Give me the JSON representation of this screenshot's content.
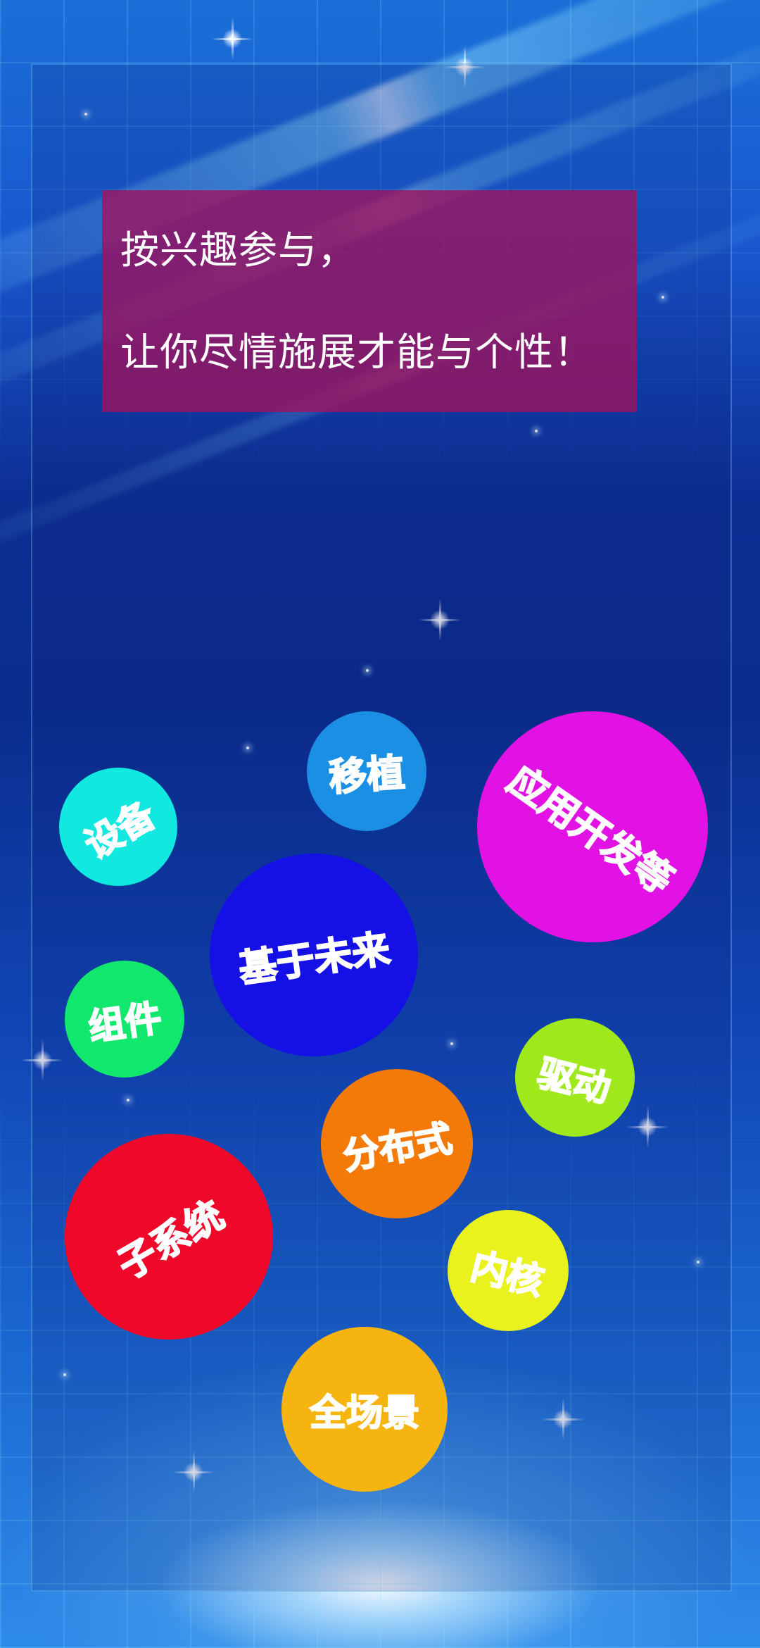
{
  "card": {
    "line1": "按兴趣参与，",
    "line2": "让你尽情施展才能与个性！"
  },
  "bubbles": {
    "yizhi": "移植",
    "yingyong": "应用开发等",
    "shebei": "设备",
    "jiyu": "基于未来",
    "zujian": "组件",
    "qudong": "驱动",
    "fenbushi": "分布式",
    "zixitong": "子系统",
    "neihe": "内核",
    "quanchangjing": "全场景"
  },
  "colors": {
    "card_bg": "#a0125c",
    "yizhi": "#1a8fe3",
    "yingyong": "#e212e4",
    "shebei": "#10e8e0",
    "jiyu": "#1410e6",
    "zujian": "#12e86e",
    "qudong": "#9ee81c",
    "fenbushi": "#f47a08",
    "zixitong": "#f0082a",
    "neihe": "#eaf21e",
    "quanchangjing": "#f6b410"
  }
}
